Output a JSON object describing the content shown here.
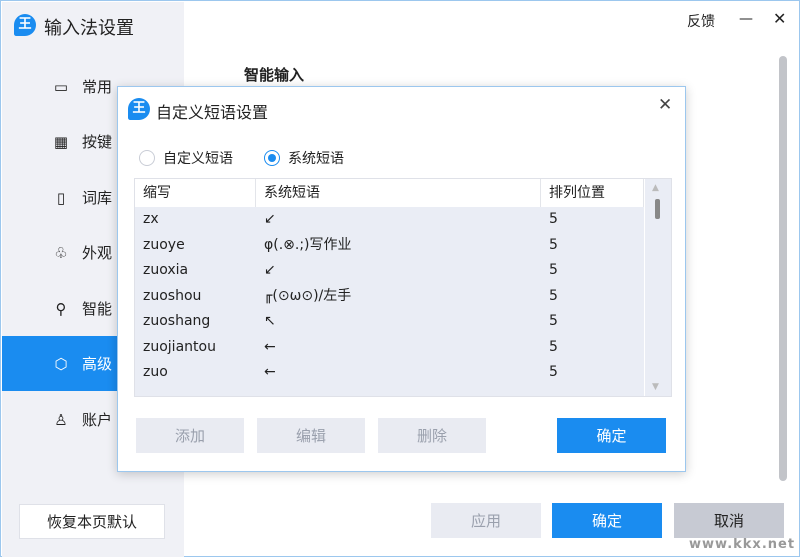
{
  "window": {
    "title": "输入法设置",
    "feedback": "反馈",
    "minimize": "—",
    "close": "✕",
    "section_title": "智能输入"
  },
  "sidebar": {
    "items": [
      {
        "label": "常用",
        "icon": "▭"
      },
      {
        "label": "按键",
        "icon": "▦"
      },
      {
        "label": "词库",
        "icon": "▯"
      },
      {
        "label": "外观",
        "icon": "♧"
      },
      {
        "label": "智能",
        "icon": "⚲"
      },
      {
        "label": "高级",
        "icon": "⬡"
      },
      {
        "label": "账户",
        "icon": "♙"
      }
    ],
    "restore": "恢复本页默认"
  },
  "footer": {
    "apply": "应用",
    "ok": "确定",
    "cancel": "取消"
  },
  "dialog": {
    "title": "自定义短语设置",
    "close": "✕",
    "radios": [
      {
        "label": "自定义短语",
        "checked": false
      },
      {
        "label": "系统短语",
        "checked": true
      }
    ],
    "columns": [
      "缩写",
      "系统短语",
      "排列位置"
    ],
    "rows": [
      [
        "zx",
        "↙",
        "5"
      ],
      [
        "zuoye",
        "φ(.⊗.;)写作业",
        "5"
      ],
      [
        "zuoxia",
        "↙",
        "5"
      ],
      [
        "zuoshou",
        "╓(⊙ω⊙)/左手",
        "5"
      ],
      [
        "zuoshang",
        "↖",
        "5"
      ],
      [
        "zuojiantou",
        "←",
        "5"
      ],
      [
        "zuo",
        "←",
        "5"
      ]
    ],
    "buttons": {
      "add": "添加",
      "edit": "编辑",
      "delete": "删除",
      "ok": "确定"
    }
  },
  "watermark": "www.kkx.net",
  "logo": "王",
  "colors": {
    "accent": "#1a8cf0"
  }
}
